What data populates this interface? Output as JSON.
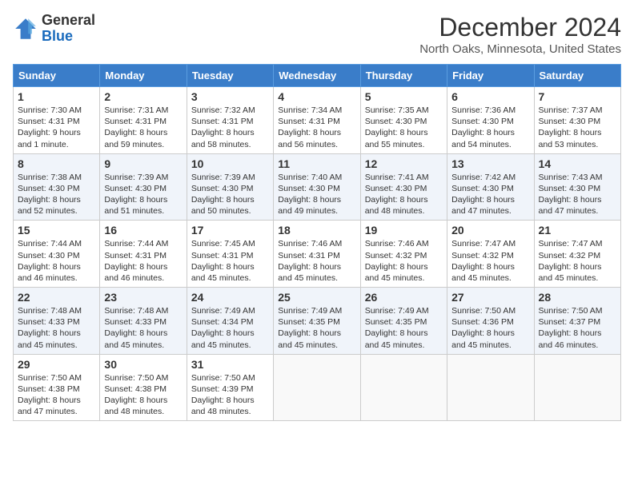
{
  "header": {
    "logo_general": "General",
    "logo_blue": "Blue",
    "month_title": "December 2024",
    "location": "North Oaks, Minnesota, United States"
  },
  "days_of_week": [
    "Sunday",
    "Monday",
    "Tuesday",
    "Wednesday",
    "Thursday",
    "Friday",
    "Saturday"
  ],
  "weeks": [
    [
      {
        "day": "1",
        "sunrise": "7:30 AM",
        "sunset": "4:31 PM",
        "daylight": "9 hours and 1 minute."
      },
      {
        "day": "2",
        "sunrise": "7:31 AM",
        "sunset": "4:31 PM",
        "daylight": "8 hours and 59 minutes."
      },
      {
        "day": "3",
        "sunrise": "7:32 AM",
        "sunset": "4:31 PM",
        "daylight": "8 hours and 58 minutes."
      },
      {
        "day": "4",
        "sunrise": "7:34 AM",
        "sunset": "4:31 PM",
        "daylight": "8 hours and 56 minutes."
      },
      {
        "day": "5",
        "sunrise": "7:35 AM",
        "sunset": "4:30 PM",
        "daylight": "8 hours and 55 minutes."
      },
      {
        "day": "6",
        "sunrise": "7:36 AM",
        "sunset": "4:30 PM",
        "daylight": "8 hours and 54 minutes."
      },
      {
        "day": "7",
        "sunrise": "7:37 AM",
        "sunset": "4:30 PM",
        "daylight": "8 hours and 53 minutes."
      }
    ],
    [
      {
        "day": "8",
        "sunrise": "7:38 AM",
        "sunset": "4:30 PM",
        "daylight": "8 hours and 52 minutes."
      },
      {
        "day": "9",
        "sunrise": "7:39 AM",
        "sunset": "4:30 PM",
        "daylight": "8 hours and 51 minutes."
      },
      {
        "day": "10",
        "sunrise": "7:39 AM",
        "sunset": "4:30 PM",
        "daylight": "8 hours and 50 minutes."
      },
      {
        "day": "11",
        "sunrise": "7:40 AM",
        "sunset": "4:30 PM",
        "daylight": "8 hours and 49 minutes."
      },
      {
        "day": "12",
        "sunrise": "7:41 AM",
        "sunset": "4:30 PM",
        "daylight": "8 hours and 48 minutes."
      },
      {
        "day": "13",
        "sunrise": "7:42 AM",
        "sunset": "4:30 PM",
        "daylight": "8 hours and 47 minutes."
      },
      {
        "day": "14",
        "sunrise": "7:43 AM",
        "sunset": "4:30 PM",
        "daylight": "8 hours and 47 minutes."
      }
    ],
    [
      {
        "day": "15",
        "sunrise": "7:44 AM",
        "sunset": "4:30 PM",
        "daylight": "8 hours and 46 minutes."
      },
      {
        "day": "16",
        "sunrise": "7:44 AM",
        "sunset": "4:31 PM",
        "daylight": "8 hours and 46 minutes."
      },
      {
        "day": "17",
        "sunrise": "7:45 AM",
        "sunset": "4:31 PM",
        "daylight": "8 hours and 45 minutes."
      },
      {
        "day": "18",
        "sunrise": "7:46 AM",
        "sunset": "4:31 PM",
        "daylight": "8 hours and 45 minutes."
      },
      {
        "day": "19",
        "sunrise": "7:46 AM",
        "sunset": "4:32 PM",
        "daylight": "8 hours and 45 minutes."
      },
      {
        "day": "20",
        "sunrise": "7:47 AM",
        "sunset": "4:32 PM",
        "daylight": "8 hours and 45 minutes."
      },
      {
        "day": "21",
        "sunrise": "7:47 AM",
        "sunset": "4:32 PM",
        "daylight": "8 hours and 45 minutes."
      }
    ],
    [
      {
        "day": "22",
        "sunrise": "7:48 AM",
        "sunset": "4:33 PM",
        "daylight": "8 hours and 45 minutes."
      },
      {
        "day": "23",
        "sunrise": "7:48 AM",
        "sunset": "4:33 PM",
        "daylight": "8 hours and 45 minutes."
      },
      {
        "day": "24",
        "sunrise": "7:49 AM",
        "sunset": "4:34 PM",
        "daylight": "8 hours and 45 minutes."
      },
      {
        "day": "25",
        "sunrise": "7:49 AM",
        "sunset": "4:35 PM",
        "daylight": "8 hours and 45 minutes."
      },
      {
        "day": "26",
        "sunrise": "7:49 AM",
        "sunset": "4:35 PM",
        "daylight": "8 hours and 45 minutes."
      },
      {
        "day": "27",
        "sunrise": "7:50 AM",
        "sunset": "4:36 PM",
        "daylight": "8 hours and 45 minutes."
      },
      {
        "day": "28",
        "sunrise": "7:50 AM",
        "sunset": "4:37 PM",
        "daylight": "8 hours and 46 minutes."
      }
    ],
    [
      {
        "day": "29",
        "sunrise": "7:50 AM",
        "sunset": "4:38 PM",
        "daylight": "8 hours and 47 minutes."
      },
      {
        "day": "30",
        "sunrise": "7:50 AM",
        "sunset": "4:38 PM",
        "daylight": "8 hours and 48 minutes."
      },
      {
        "day": "31",
        "sunrise": "7:50 AM",
        "sunset": "4:39 PM",
        "daylight": "8 hours and 48 minutes."
      },
      null,
      null,
      null,
      null
    ]
  ]
}
